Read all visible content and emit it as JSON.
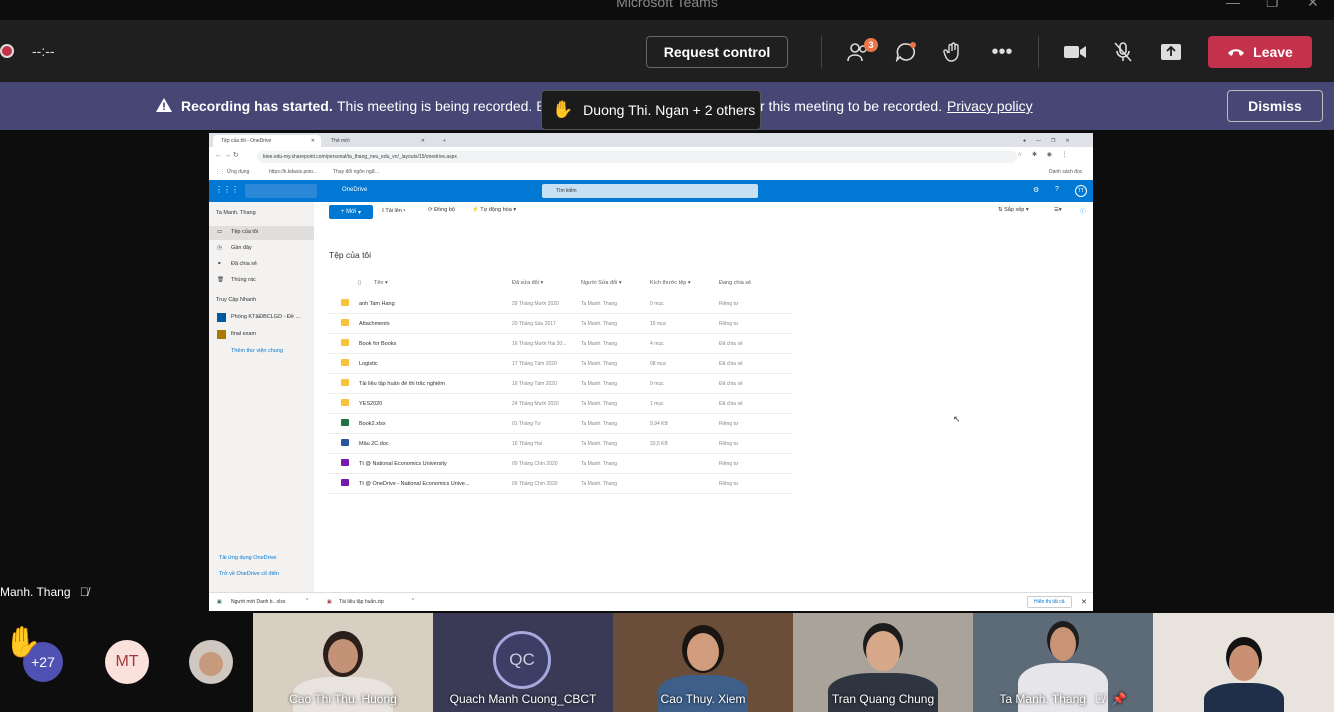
{
  "window": {
    "title": "Microsoft Teams"
  },
  "controls": {
    "timer": "--:--",
    "request_control": "Request control",
    "participants_badge": "3",
    "leave": "Leave",
    "icons": [
      "participants-icon",
      "chat-icon",
      "reactions-icon",
      "more-icon",
      "camera-icon",
      "mic-muted-icon",
      "share-icon",
      "phone-icon"
    ]
  },
  "banner": {
    "strong": "Recording has started.",
    "text_a": "This meeting is being recorded. B",
    "text_b": "r this meeting to be recorded.",
    "privacy_link": "Privacy policy",
    "dismiss": "Dismiss",
    "raised_hand": "Duong Thi. Ngan + 2 others"
  },
  "shared_screen": {
    "browser": {
      "tab_active": "Tệp của tôi - OneDrive",
      "tab_inactive": "Thẻ mới",
      "url": "ktee.edu-my.sharepoint.com/personal/ta_thang_neu_edu_vn/_layouts/15/onedrive.aspx",
      "bookmarks": [
        "Ứng dụng",
        "https://k.kdasis.poio...",
        "Thay đổi ngôn ngữ..."
      ],
      "reading_list": "Danh sách đọc"
    },
    "onedrive": {
      "app_name": "OneDrive",
      "search_placeholder": "Tìm kiếm",
      "avatar": "TT",
      "user": "Ta Manh. Thang",
      "nav": [
        "Tệp của tôi",
        "Gần đây",
        "Đã chia sẻ",
        "Thùng rác"
      ],
      "quick_access_title": "Truy Cập Nhanh",
      "quick_access": [
        "Phòng KT&ĐBCLGD - Đề ...",
        "final exam"
      ],
      "more_places": "Thêm thư viện chung",
      "footer_links": [
        "Tải ứng dụng OneDrive",
        "Trở về OneDrive cổ điển"
      ],
      "commands": [
        "Mới",
        "Tải lên",
        "Đồng bộ",
        "Tự động hóa"
      ],
      "sort": "Sắp xếp",
      "page_title": "Tệp của tôi",
      "columns": [
        "Tên",
        "Đã sửa đổi",
        "Người Sửa đổi",
        "Kích thước tệp",
        "Đang chia sẻ"
      ],
      "files": [
        {
          "name": "anh Tam Hang",
          "modified": "29 Tháng Mười 2020",
          "by": "Ta Manh. Thang",
          "size": "0 mục",
          "sharing": "Riêng tư",
          "kind": "folder"
        },
        {
          "name": "Attachments",
          "modified": "20 Tháng Sáu 2017",
          "by": "Ta Manh. Thang",
          "size": "15 mục",
          "sharing": "Riêng tư",
          "kind": "folder"
        },
        {
          "name": "Book for Books",
          "modified": "16 Tháng Mười Hai 20...",
          "by": "Ta Manh. Thang",
          "size": "4 mục",
          "sharing": "Đã chia sẻ",
          "kind": "folder"
        },
        {
          "name": "Logistic",
          "modified": "17 Tháng Tám 2020",
          "by": "Ta Manh. Thang",
          "size": "08 mục",
          "sharing": "Đã chia sẻ",
          "kind": "folder"
        },
        {
          "name": "Tài liệu tập huấn đề thi trắc nghiệm",
          "modified": "19 Tháng Tám 2020",
          "by": "Ta Manh. Thang",
          "size": "9 mục",
          "sharing": "Đã chia sẻ",
          "kind": "folder"
        },
        {
          "name": "YES2020",
          "modified": "24 Tháng Mười 2020",
          "by": "Ta Manh. Thang",
          "size": "1 mục",
          "sharing": "Đã chia sẻ",
          "kind": "folder"
        },
        {
          "name": "Book2.xlsx",
          "modified": "01 Tháng Tư",
          "by": "Ta Manh. Thang",
          "size": "9,94 KB",
          "sharing": "Riêng tư",
          "kind": "excel"
        },
        {
          "name": "Mẫu 2C.doc",
          "modified": "16 Tháng Hai",
          "by": "Ta Manh. Thang",
          "size": "33,5 KB",
          "sharing": "Riêng tư",
          "kind": "word"
        },
        {
          "name": "Tt @ National Economics University",
          "modified": "09 Tháng Chín 2020",
          "by": "Ta Manh. Thang",
          "size": "",
          "sharing": "Riêng tư",
          "kind": "onenote"
        },
        {
          "name": "Tt @ OneDrive - National Economics Unive...",
          "modified": "09 Tháng Chín 2020",
          "by": "Ta Manh. Thang",
          "size": "",
          "sharing": "Riêng tư",
          "kind": "onenote"
        }
      ]
    },
    "downloads": [
      "Người mới Danh b...xlsx",
      "Tài liệu tập huấn.zip"
    ],
    "show_all": "Hiển thị tất cả"
  },
  "presenter_label": "Manh. Thang",
  "participants": {
    "overflow": "+27",
    "avatar_initials": "MT",
    "qc_initials": "QC",
    "tiles": [
      "Cao Thi Thu. Huong",
      "Quach Manh Cuong_CBCT",
      "Cao Thuy. Xiem",
      "Tran Quang Chung",
      "Ta Manh. Thang"
    ]
  },
  "colors": {
    "leave": "#c4314b",
    "banner": "#464775",
    "onedrive": "#0078d4",
    "badge": "#e97548"
  }
}
